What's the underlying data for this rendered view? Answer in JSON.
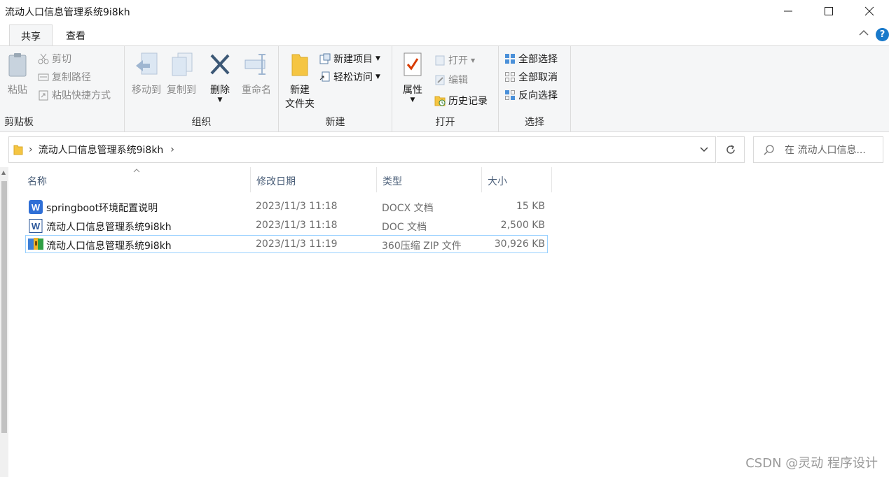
{
  "window": {
    "title": "流动人口信息管理系统9i8kh"
  },
  "tabs": [
    "共享",
    "查看"
  ],
  "ribbon": {
    "clipboard": {
      "paste": "粘贴",
      "cut": "剪切",
      "copy_path": "复制路径",
      "paste_shortcut": "粘贴快捷方式",
      "label": "剪贴板"
    },
    "organize": {
      "move_to": "移动到",
      "copy_to": "复制到",
      "delete": "删除",
      "rename": "重命名",
      "label": "组织"
    },
    "new": {
      "new_folder_1": "新建",
      "new_folder_2": "文件夹",
      "new_item": "新建项目",
      "easy_access": "轻松访问",
      "label": "新建"
    },
    "open": {
      "properties": "属性",
      "open": "打开",
      "edit": "编辑",
      "history": "历史记录",
      "label": "打开"
    },
    "select": {
      "select_all": "全部选择",
      "select_none": "全部取消",
      "invert": "反向选择",
      "label": "选择"
    }
  },
  "address": {
    "path": "流动人口信息管理系统9i8kh",
    "search_placeholder": "在 流动人口信息..."
  },
  "columns": [
    "名称",
    "修改日期",
    "类型",
    "大小"
  ],
  "files": [
    {
      "name": "springboot环境配置说明",
      "date": "2023/11/3 11:18",
      "type": "DOCX 文档",
      "size": "15 KB",
      "icon": "wps-docx-icon"
    },
    {
      "name": "流动人口信息管理系统9i8kh",
      "date": "2023/11/3 11:18",
      "type": "DOC 文档",
      "size": "2,500 KB",
      "icon": "word-doc-icon"
    },
    {
      "name": "流动人口信息管理系统9i8kh",
      "date": "2023/11/3 11:19",
      "type": "360压缩 ZIP 文件",
      "size": "30,926 KB",
      "icon": "zip-archive-icon"
    }
  ],
  "watermark": "CSDN @灵动 程序设计",
  "colors": {
    "accent": "#1979ca",
    "selection_border": "#99d1ff",
    "ribbon_bg": "#f5f6f7",
    "header_text": "#4c607a"
  }
}
